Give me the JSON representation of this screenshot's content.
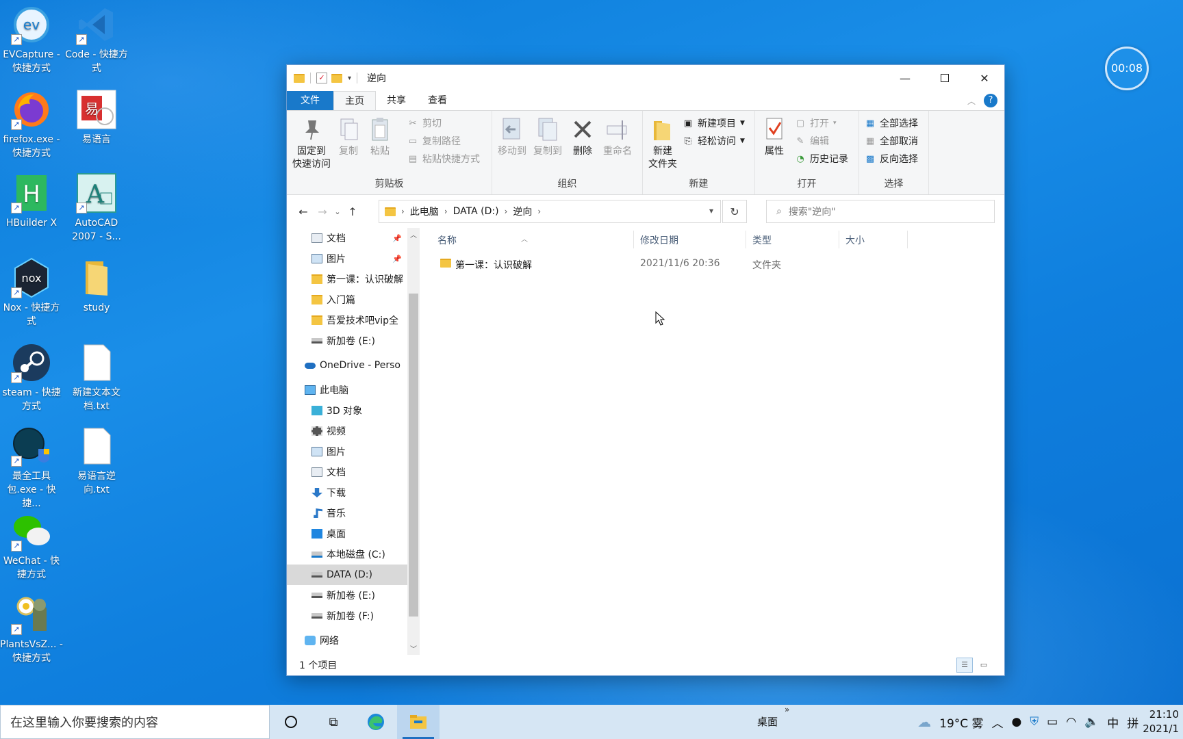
{
  "desktop": {
    "icons": [
      {
        "label": "EVCapture - 快捷方式",
        "icon": "evcapture-icon"
      },
      {
        "label": "Code - 快捷方式",
        "icon": "vscode-icon"
      },
      {
        "label": "firefox.exe - 快捷方式",
        "icon": "firefox-icon"
      },
      {
        "label": "易语言",
        "icon": "eyuyan-icon"
      },
      {
        "label": "HBuilder X",
        "icon": "hbuilder-icon"
      },
      {
        "label": "AutoCAD 2007 - S...",
        "icon": "autocad-icon"
      },
      {
        "label": "Nox - 快捷方式",
        "icon": "nox-icon"
      },
      {
        "label": "study",
        "icon": "folder-icon"
      },
      {
        "label": "steam - 快捷方式",
        "icon": "steam-icon"
      },
      {
        "label": "新建文本文档.txt",
        "icon": "text-file-icon"
      },
      {
        "label": "最全工具包.exe - 快捷...",
        "icon": "toolkit-icon"
      },
      {
        "label": "易语言逆向.txt",
        "icon": "text-file-icon"
      },
      {
        "label": "WeChat - 快捷方式",
        "icon": "wechat-icon"
      },
      {
        "label": "PlantsVsZ... - 快捷方式",
        "icon": "pvz-icon"
      }
    ],
    "timer": "00:08"
  },
  "window": {
    "title": "逆向",
    "tabs": {
      "file": "文件",
      "home": "主页",
      "share": "共享",
      "view": "查看"
    },
    "ribbon": {
      "clipboard": {
        "label": "剪贴板",
        "pin": "固定到\n快速访问",
        "copy": "复制",
        "paste": "粘贴",
        "cut": "剪切",
        "copy_path": "复制路径",
        "paste_shortcut": "粘贴快捷方式"
      },
      "organize": {
        "label": "组织",
        "move_to": "移动到",
        "copy_to": "复制到",
        "delete": "删除",
        "rename": "重命名"
      },
      "new": {
        "label": "新建",
        "new_folder": "新建\n文件夹",
        "new_item": "新建项目",
        "easy_access": "轻松访问"
      },
      "open": {
        "label": "打开",
        "properties": "属性",
        "open": "打开",
        "edit": "编辑",
        "history": "历史记录"
      },
      "select": {
        "label": "选择",
        "select_all": "全部选择",
        "select_none": "全部取消",
        "invert": "反向选择"
      }
    },
    "address": {
      "crumbs": [
        "此电脑",
        "DATA (D:)",
        "逆向"
      ],
      "search_placeholder": "搜索\"逆向\""
    },
    "nav": [
      {
        "label": "文档",
        "icon": "documents-icon",
        "pinned": true,
        "indent": 1
      },
      {
        "label": "图片",
        "icon": "pictures-icon",
        "pinned": true,
        "indent": 1
      },
      {
        "label": "第一课：认识破解",
        "icon": "folder-icon",
        "indent": 1
      },
      {
        "label": "入门篇",
        "icon": "folder-icon",
        "indent": 1
      },
      {
        "label": "吾爱技术吧vip全",
        "icon": "folder-icon",
        "indent": 1
      },
      {
        "label": "新加卷 (E:)",
        "icon": "drive-icon",
        "indent": 1
      },
      {
        "label": "OneDrive - Perso",
        "icon": "onedrive-icon",
        "indent": 0
      },
      {
        "label": "此电脑",
        "icon": "this-pc-icon",
        "indent": 0
      },
      {
        "label": "3D 对象",
        "icon": "3d-objects-icon",
        "indent": 1
      },
      {
        "label": "视频",
        "icon": "videos-icon",
        "indent": 1
      },
      {
        "label": "图片",
        "icon": "pictures-icon",
        "indent": 1
      },
      {
        "label": "文档",
        "icon": "documents-icon",
        "indent": 1
      },
      {
        "label": "下载",
        "icon": "downloads-icon",
        "indent": 1
      },
      {
        "label": "音乐",
        "icon": "music-icon",
        "indent": 1
      },
      {
        "label": "桌面",
        "icon": "desktop-icon",
        "indent": 1
      },
      {
        "label": "本地磁盘 (C:)",
        "icon": "system-drive-icon",
        "indent": 1
      },
      {
        "label": "DATA (D:)",
        "icon": "drive-icon",
        "indent": 1,
        "selected": true
      },
      {
        "label": "新加卷 (E:)",
        "icon": "drive-icon",
        "indent": 1
      },
      {
        "label": "新加卷 (F:)",
        "icon": "drive-icon",
        "indent": 1
      },
      {
        "label": "网络",
        "icon": "network-icon",
        "indent": 0
      }
    ],
    "columns": {
      "name": "名称",
      "modified": "修改日期",
      "type": "类型",
      "size": "大小"
    },
    "files": [
      {
        "name": "第一课：认识破解",
        "modified": "2021/11/6 20:36",
        "type": "文件夹",
        "size": ""
      }
    ],
    "status": "1 个项目"
  },
  "taskbar": {
    "search_placeholder": "在这里输入你要搜索的内容",
    "desktop_label": "桌面",
    "weather": "19°C 雾",
    "ime_lang": "中",
    "ime_mode": "拼",
    "time": "21:10",
    "date": "2021/1"
  },
  "colors": {
    "accent": "#1979ca",
    "folder": "#f4c542",
    "desktop": "#0f7fde"
  }
}
